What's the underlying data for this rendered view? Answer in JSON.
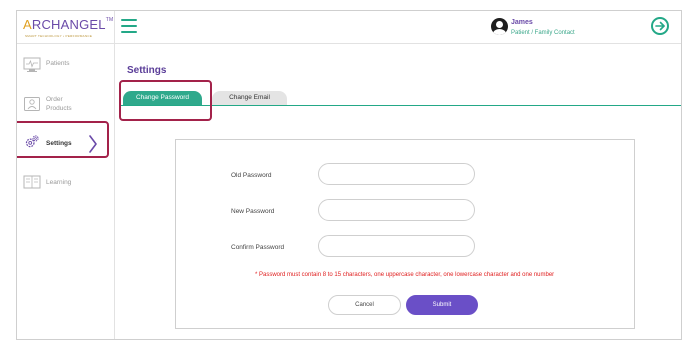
{
  "app": {
    "logo_first": "A",
    "logo_rest": "RCHANGEL",
    "logo_tm": "TM",
    "logo_tagline": "SMART TECHNOLOGY • PERFORMANCE"
  },
  "header": {
    "user_name": "James",
    "user_role": "Patient / Family Contact"
  },
  "sidebar": {
    "items": [
      {
        "label": "Patients",
        "icon": "monitor-icon"
      },
      {
        "label": "Order",
        "label2": "Products",
        "icon": "order-products-icon"
      },
      {
        "label": "Settings",
        "icon": "gear-icon"
      },
      {
        "label": "Learning",
        "icon": "learning-icon"
      }
    ]
  },
  "main": {
    "title": "Settings",
    "tabs": [
      {
        "label": "Change Password",
        "active": true
      },
      {
        "label": "Change Email",
        "active": false
      }
    ],
    "form": {
      "old_password_label": "Old Password",
      "new_password_label": "New Password",
      "confirm_password_label": "Confirm Password",
      "old_password_value": "",
      "new_password_value": "",
      "confirm_password_value": "",
      "note": "* Password must contain 8 to 15 characters, one uppercase character, one lowercase character and one number",
      "cancel_label": "Cancel",
      "submit_label": "Submit"
    }
  },
  "colors": {
    "brand_purple": "#6a4aa8",
    "brand_green": "#23a887",
    "highlight": "#a3224a",
    "error": "#e02020"
  }
}
